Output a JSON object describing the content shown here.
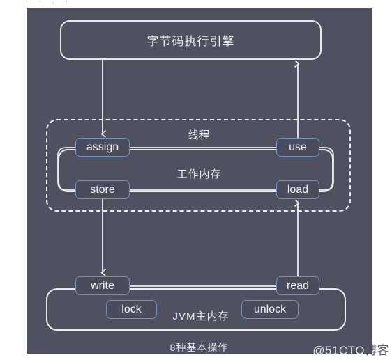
{
  "page": {
    "background": "#ffffff",
    "panel_color": "#4f5161",
    "accent_color": "#6e92c4",
    "line_color": "#eceef4",
    "clipped_top_text": "· · , ·"
  },
  "diagram": {
    "title": "字节码执行引擎",
    "thread_label": "线程",
    "working_memory_label": "工作内存",
    "main_memory_label": "JVM主内存",
    "caption": "8种基本操作",
    "operations": [
      {
        "id": "assign",
        "label": "assign"
      },
      {
        "id": "use",
        "label": "use"
      },
      {
        "id": "store",
        "label": "store"
      },
      {
        "id": "load",
        "label": "load"
      },
      {
        "id": "write",
        "label": "write"
      },
      {
        "id": "read",
        "label": "read"
      },
      {
        "id": "lock",
        "label": "lock"
      },
      {
        "id": "unlock",
        "label": "unlock"
      }
    ],
    "connections": [
      {
        "from": "engine",
        "to": "assign",
        "direction": "down",
        "arrow": true
      },
      {
        "from": "use",
        "to": "engine",
        "direction": "up",
        "arrow": true
      },
      {
        "from": "store",
        "to": "write",
        "direction": "down",
        "arrow": true
      },
      {
        "from": "read",
        "to": "load",
        "direction": "up",
        "arrow": true
      },
      {
        "from": "assign",
        "to": "use",
        "direction": "horizontal",
        "arrow": false
      },
      {
        "from": "store",
        "to": "load",
        "direction": "horizontal",
        "arrow": false
      },
      {
        "from": "write",
        "to": "read",
        "direction": "horizontal",
        "arrow": false
      },
      {
        "from": "assign",
        "to": "store",
        "direction": "left-loop",
        "arrow": false
      },
      {
        "from": "use",
        "to": "load",
        "direction": "right-loop",
        "arrow": false
      },
      {
        "from": "write",
        "to": "read",
        "direction": "main-memory-loop",
        "arrow": false
      }
    ]
  },
  "watermark": {
    "text_primary": "@51CTO",
    "text_secondary": "博客"
  }
}
